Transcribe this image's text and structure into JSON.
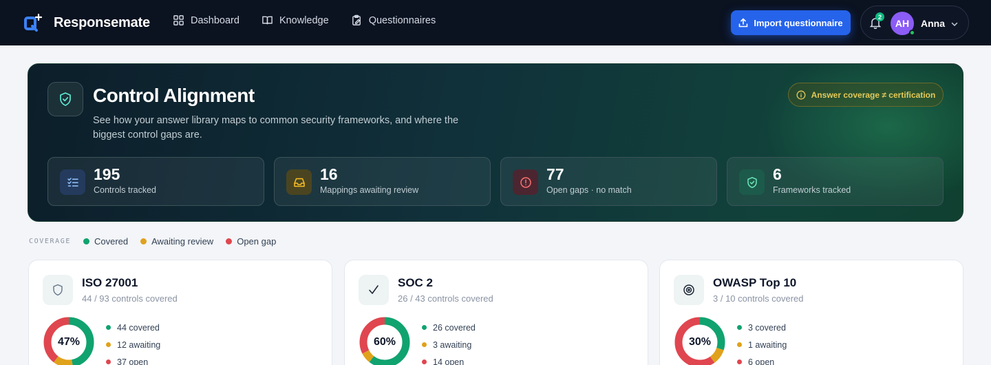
{
  "app": {
    "name": "Responsemate"
  },
  "nav": [
    {
      "label": "Dashboard",
      "icon": "grid-icon"
    },
    {
      "label": "Knowledge",
      "icon": "book-icon"
    },
    {
      "label": "Questionnaires",
      "icon": "clipboard-edit-icon"
    }
  ],
  "header": {
    "import_label": "Import questionnaire",
    "notification_count": "2",
    "user_initials": "AH",
    "user_name": "Anna"
  },
  "hero": {
    "title": "Control Alignment",
    "description": "See how your answer library maps to common security frameworks, and where the biggest control gaps are.",
    "note": "Answer coverage ≠ certification",
    "stats": [
      {
        "value": "195",
        "label": "Controls tracked",
        "icon": "checklist-icon"
      },
      {
        "value": "16",
        "label": "Mappings awaiting review",
        "icon": "inbox-icon"
      },
      {
        "value": "77",
        "label": "Open gaps · no match",
        "icon": "alert-circle-icon"
      },
      {
        "value": "6",
        "label": "Frameworks tracked",
        "icon": "shield-check-icon"
      }
    ]
  },
  "legend": {
    "title": "COVERAGE",
    "items": [
      {
        "label": "Covered",
        "color": "#10a36f"
      },
      {
        "label": "Awaiting review",
        "color": "#e0a21b"
      },
      {
        "label": "Open gap",
        "color": "#e0464f"
      }
    ]
  },
  "frameworks": [
    {
      "name": "ISO 27001",
      "summary": "44 / 93 controls covered",
      "percent": "47%",
      "covered": 44,
      "awaiting": 12,
      "open": 37,
      "covered_label": "44 covered",
      "awaiting_label": "12 awaiting",
      "open_label": "37 open",
      "icon": "shield-icon"
    },
    {
      "name": "SOC 2",
      "summary": "26 / 43 controls covered",
      "percent": "60%",
      "covered": 26,
      "awaiting": 3,
      "open": 14,
      "covered_label": "26 covered",
      "awaiting_label": "3 awaiting",
      "open_label": "14 open",
      "icon": "checkmark-icon"
    },
    {
      "name": "OWASP Top 10",
      "summary": "3 / 10 controls covered",
      "percent": "30%",
      "covered": 3,
      "awaiting": 1,
      "open": 6,
      "covered_label": "3 covered",
      "awaiting_label": "1 awaiting",
      "open_label": "6 open",
      "icon": "target-icon"
    }
  ]
}
